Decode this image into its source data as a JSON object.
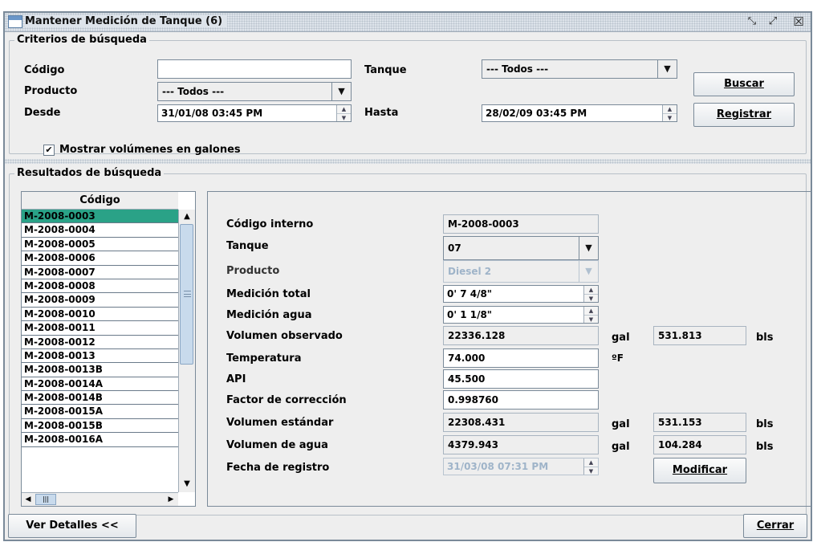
{
  "window": {
    "title": "Mantener Medición de Tanque (6)",
    "minimize_glyph": "⤡",
    "maximize_glyph": "⤢",
    "close_glyph": "☒"
  },
  "search": {
    "legend": "Criterios de búsqueda",
    "codigo_label": "Código",
    "codigo_value": "",
    "tanque_label": "Tanque",
    "tanque_value": "--- Todos ---",
    "producto_label": "Producto",
    "producto_value": "--- Todos ---",
    "desde_label": "Desde",
    "desde_value": "31/01/08 03:45 PM",
    "hasta_label": "Hasta",
    "hasta_value": "28/02/09 03:45 PM",
    "galones_label": "Mostrar volúmenes en galones",
    "galones_checked": true,
    "check_glyph": "✔",
    "buscar_label": "Buscar",
    "registrar_label": "Registrar"
  },
  "results": {
    "legend": "Resultados de búsqueda",
    "column_header": "Código",
    "rows": [
      "M-2008-0003",
      "M-2008-0004",
      "M-2008-0005",
      "M-2008-0006",
      "M-2008-0007",
      "M-2008-0008",
      "M-2008-0009",
      "M-2008-0010",
      "M-2008-0011",
      "M-2008-0012",
      "M-2008-0013",
      "M-2008-0013B",
      "M-2008-0014A",
      "M-2008-0014B",
      "M-2008-0015A",
      "M-2008-0015B",
      "M-2008-0016A"
    ],
    "selected_index": 0
  },
  "detail": {
    "codigo_interno_label": "Código interno",
    "codigo_interno_value": "M-2008-0003",
    "tanque_label": "Tanque",
    "tanque_value": "07",
    "producto_label": "Producto",
    "producto_value": "Diesel 2",
    "medicion_total_label": "Medición total",
    "medicion_total_value": "0' 7 4/8\"",
    "medicion_agua_label": "Medición agua",
    "medicion_agua_value": "0' 1 1/8\"",
    "volumen_observado_label": "Volumen observado",
    "volumen_observado_value": "22336.128",
    "volumen_observado_bls": "531.813",
    "temperatura_label": "Temperatura",
    "temperatura_value": "74.000",
    "temperatura_unit": "ºF",
    "api_label": "API",
    "api_value": "45.500",
    "factor_label": "Factor de corrección",
    "factor_value": "0.998760",
    "volumen_estandar_label": "Volumen estándar",
    "volumen_estandar_value": "22308.431",
    "volumen_estandar_bls": "531.153",
    "volumen_agua_label": "Volumen de agua",
    "volumen_agua_value": "4379.943",
    "volumen_agua_bls": "104.284",
    "fecha_label": "Fecha de registro",
    "fecha_value": "31/03/08 07:31 PM",
    "unit_gal": "gal",
    "unit_bls": "bls",
    "modificar_label": "Modificar"
  },
  "footer": {
    "ver_detalles_label": "Ver Detalles <<",
    "cerrar_label": "Cerrar"
  },
  "icons": {
    "combo_arrow": "▼",
    "spin_up": "▲",
    "spin_down": "▼",
    "scroll_up": "▲",
    "scroll_down": "▼",
    "scroll_left": "◀",
    "scroll_right": "▶",
    "hthumb_grip": "|||"
  },
  "colors": {
    "selection": "#2aa287",
    "window_border": "#7a8a99",
    "disabled_text": "#9fb4c9"
  }
}
